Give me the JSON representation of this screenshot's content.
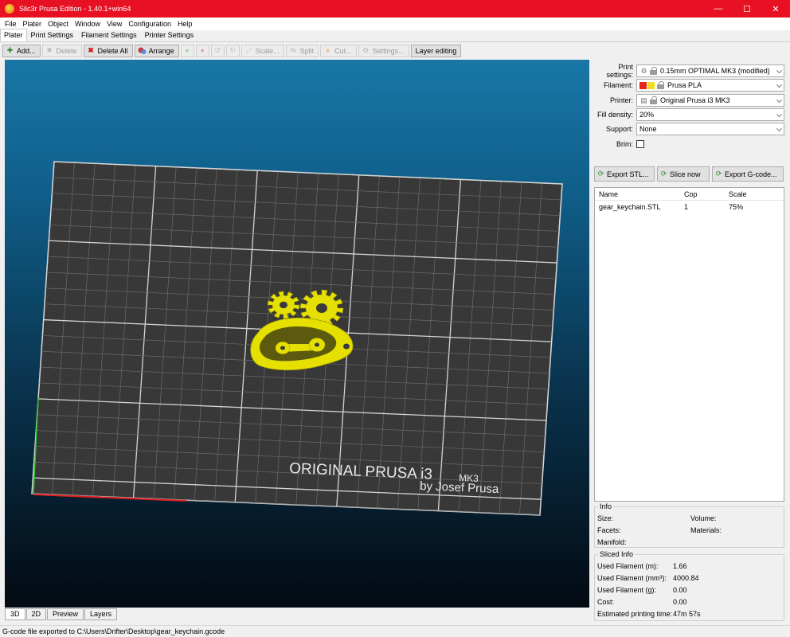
{
  "window": {
    "title": "Slic3r Prusa Edition - 1.40.1+win64",
    "minimize": "—",
    "maximize": "☐",
    "close": "✕"
  },
  "menubar": [
    "File",
    "Plater",
    "Object",
    "Window",
    "View",
    "Configuration",
    "Help"
  ],
  "tabs": [
    "Plater",
    "Print Settings",
    "Filament Settings",
    "Printer Settings"
  ],
  "toolbar": {
    "add": "Add...",
    "delete": "Delete",
    "delete_all": "Delete All",
    "arrange": "Arrange",
    "scale": "Scale...",
    "split": "Split",
    "cut": "Cut...",
    "settings": "Settings...",
    "layer_editing": "Layer editing"
  },
  "viewport": {
    "bed_text_line1": "ORIGINAL PRUSA i3",
    "bed_text_mk3": "MK3",
    "bed_text_line2": "by Josef Prusa",
    "model_color": "#e5e000"
  },
  "view_tabs": [
    "3D",
    "2D",
    "Preview",
    "Layers"
  ],
  "settings": {
    "print_label": "Print settings:",
    "print_value": "0.15mm OPTIMAL MK3 (modified)",
    "filament_label": "Filament:",
    "filament_value": "Prusa PLA",
    "filament_colors": [
      "#e8231c",
      "#f3dc1b"
    ],
    "printer_label": "Printer:",
    "printer_value": "Original Prusa i3 MK3",
    "fill_label": "Fill density:",
    "fill_value": "20%",
    "support_label": "Support:",
    "support_value": "None",
    "brim_label": "Brim:"
  },
  "actions": {
    "export_stl": "Export STL...",
    "slice_now": "Slice now",
    "export_gcode": "Export G-code..."
  },
  "object_list": {
    "headers": [
      "Name",
      "Cop",
      "Scale"
    ],
    "rows": [
      {
        "name": "gear_keychain.STL",
        "copies": "1",
        "scale": "75%"
      }
    ]
  },
  "info": {
    "title": "Info",
    "size_label": "Size:",
    "volume_label": "Volume:",
    "facets_label": "Facets:",
    "materials_label": "Materials:",
    "manifold_label": "Manifold:"
  },
  "sliced_info": {
    "title": "Sliced Info",
    "filament_m_label": "Used Filament (m):",
    "filament_m_value": "1.66",
    "filament_mm3_label": "Used Filament (mm³):",
    "filament_mm3_value": "4000.84",
    "filament_g_label": "Used Filament (g):",
    "filament_g_value": "0.00",
    "cost_label": "Cost:",
    "cost_value": "0.00",
    "time_label": "Estimated printing time:",
    "time_value": "47m 57s"
  },
  "status": "G-code file exported to C:\\Users\\Drifter\\Desktop\\gear_keychain.gcode"
}
